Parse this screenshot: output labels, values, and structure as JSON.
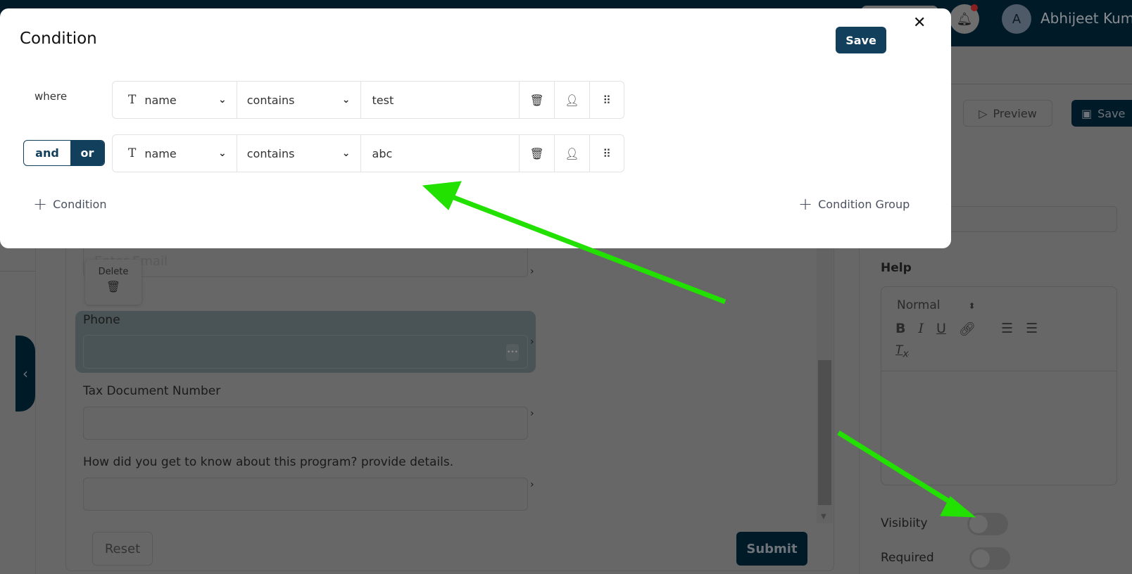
{
  "header": {
    "user_name": "Abhijeet Kumo",
    "avatar_initial": "A",
    "has_notification": true
  },
  "toolbar": {
    "preview_label": "Preview",
    "save_label": "Save"
  },
  "form": {
    "email_placeholder": "Enter Email",
    "delete_label": "Delete",
    "fields": [
      {
        "label": "Phone"
      },
      {
        "label": "Tax Document Number"
      },
      {
        "label": "How did you get to know about this program? provide details."
      }
    ],
    "reset_label": "Reset",
    "submit_label": "Submit"
  },
  "settings": {
    "placeholder_label_partial": "er",
    "help_label": "Help",
    "editor_format": "Normal",
    "visibility_label": "Visibiity",
    "visibility_on": false,
    "required_label": "Required",
    "required_on": false
  },
  "modal": {
    "title": "Condition",
    "save_label": "Save",
    "where_label": "where",
    "logic": {
      "and_label": "and",
      "or_label": "or",
      "selected": "or"
    },
    "rows": [
      {
        "field": "name",
        "operator": "contains",
        "value": "test"
      },
      {
        "field": "name",
        "operator": "contains",
        "value": "abc"
      }
    ],
    "add_condition_label": "Condition",
    "add_group_label": "Condition Group"
  },
  "colors": {
    "primary": "#123f5c",
    "annotation_arrow": "#22e000"
  }
}
